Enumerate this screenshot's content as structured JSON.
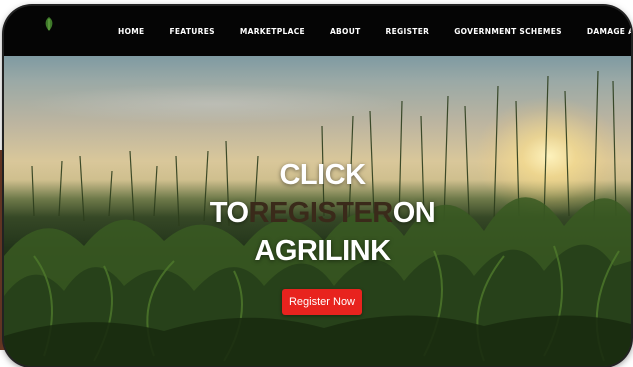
{
  "nav": {
    "logo_icon": "leaf-logo-icon",
    "items": [
      "HOME",
      "FEATURES",
      "MARKETPLACE",
      "ABOUT",
      "REGISTER",
      "GOVERNMENT SCHEMES",
      "DAMAGE ALERTS"
    ]
  },
  "hero": {
    "title_line1": "CLICK",
    "title_line2_prefix": "TO",
    "title_line2_highlight": "REGISTER",
    "title_line2_suffix": "ON",
    "title_line3": "AGRILINK",
    "cta_label": "Register Now"
  },
  "colors": {
    "accent": "#e8231e",
    "navbar": "#050505",
    "highlight_text": "#3a2a1a"
  }
}
